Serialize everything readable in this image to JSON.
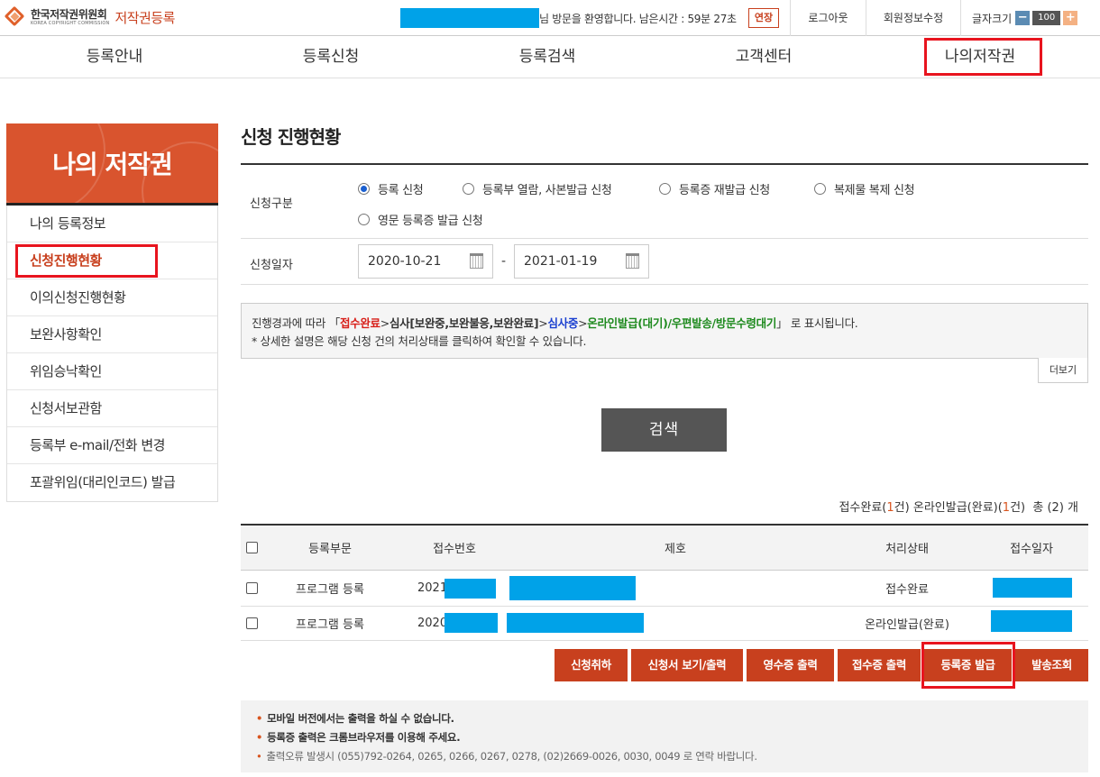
{
  "header": {
    "org_name": "한국저작권위원회",
    "org_sub": "KOREA COPYRIGHT COMMISSION",
    "site_name": "저작권등록",
    "welcome": "님 방문을 환영합니다.  남은시간 : 59분 27초",
    "extend_label": "연장",
    "logout_label": "로그아웃",
    "edit_member_label": "회원정보수정",
    "font_size_label": "글자크기",
    "font_size_value": "100",
    "font_minus": "−",
    "font_plus": "+"
  },
  "gnb": [
    "등록안내",
    "등록신청",
    "등록검색",
    "고객센터",
    "나의저작권"
  ],
  "sidebar": {
    "title": "나의 저작권",
    "items": [
      "나의 등록정보",
      "신청진행현황",
      "이의신청진행현황",
      "보완사항확인",
      "위임승낙확인",
      "신청서보관함",
      "등록부 e-mail/전화 변경",
      "포괄위임(대리인코드) 발급"
    ]
  },
  "main": {
    "title": "신청 진행현황",
    "type_label": "신청구분",
    "radios": [
      "등록 신청",
      "등록부 열람, 사본발급 신청",
      "등록증 재발급 신청",
      "복제물 복제 신청",
      "영문 등록증 발급 신청"
    ],
    "date_label": "신청일자",
    "date_from": "2020-10-21",
    "date_to": "2021-01-19",
    "date_sep": "-",
    "info": {
      "prefix": "진행경과에 따라 「",
      "s1": "접수완료",
      "g1": ">",
      "s2": "심사[보완중,보완불응,보완완료]",
      "g2": ">",
      "s3": "심사중",
      "g3": ">",
      "s4": "온라인발급(대기)/우편발송/방문수령대기",
      "suffix": "」 로 표시됩니다.",
      "line2": "* 상세한 설명은 해당 신청 건의 처리상태를 클릭하여 확인할 수 있습니다."
    },
    "more_label": "더보기",
    "search_label": "검색",
    "summary": {
      "a": "접수완료(",
      "a_n": "1",
      "a_end": "건)",
      "b": "온라인발급(완료)(",
      "b_n": "1",
      "b_end": "건)",
      "total": "총 (2) 개"
    }
  },
  "table": {
    "headers": [
      "등록부문",
      "접수번호",
      "제호",
      "처리상태",
      "접수일자"
    ],
    "rows": [
      {
        "category": "프로그램 등록",
        "number": "2021",
        "status": "접수완료"
      },
      {
        "category": "프로그램 등록",
        "number": "2020",
        "status": "온라인발급(완료)"
      }
    ]
  },
  "actions": [
    "신청취하",
    "신청서 보기/출력",
    "영수증 출력",
    "접수증 출력",
    "등록증 발급",
    "발송조회"
  ],
  "notice": [
    "모바일 버전에서는 출력을 하실 수 없습니다.",
    "등록증 출력은 크롬브라우저를 이용해 주세요.",
    "출력오류 발생시 (055)792-0264, 0265, 0266, 0267, 0278, (02)2669-0026, 0030, 0049 로 연락 바랍니다."
  ],
  "colors": {
    "brand": "#c8401e",
    "highlight": "#e8141e",
    "mask": "#00a2e8"
  }
}
